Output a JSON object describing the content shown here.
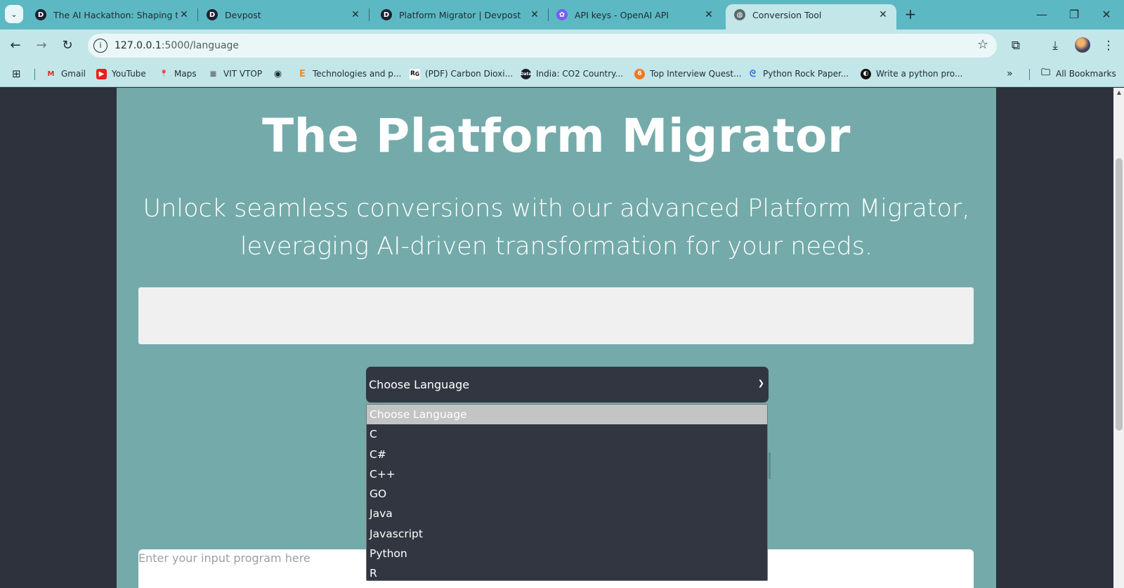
{
  "browser": {
    "tabs": [
      {
        "title": "The AI Hackathon: Shaping the",
        "favicon": "D"
      },
      {
        "title": "Devpost",
        "favicon": "D"
      },
      {
        "title": "Platform Migrator | Devpost",
        "favicon": "D"
      },
      {
        "title": "API keys - OpenAI API",
        "favicon": "openai-icon"
      },
      {
        "title": "Conversion Tool",
        "favicon": "globe-icon",
        "active": true
      }
    ],
    "url_host": "127.0.0.1",
    "url_rest": ":5000/language",
    "bookmarks": [
      {
        "label": "Gmail",
        "icon": "gmail-icon"
      },
      {
        "label": "YouTube",
        "icon": "youtube-icon"
      },
      {
        "label": "Maps",
        "icon": "maps-icon"
      },
      {
        "label": "VIT VTOP",
        "icon": "vit-icon"
      },
      {
        "label": "",
        "icon": "globe-icon"
      },
      {
        "label": "Technologies and p...",
        "icon": "e-icon"
      },
      {
        "label": "(PDF) Carbon Dioxi...",
        "icon": "researchgate-icon"
      },
      {
        "label": "India: CO2 Country...",
        "icon": "data-icon"
      },
      {
        "label": "Top Interview Quest...",
        "icon": "leetcode-icon"
      },
      {
        "label": "Python Rock Paper...",
        "icon": "python-icon"
      },
      {
        "label": "Write a python pro...",
        "icon": "github-icon"
      }
    ],
    "all_bookmarks_label": "All Bookmarks"
  },
  "page": {
    "heading": "The Platform Migrator",
    "subtitle": "Unlock seamless conversions with our advanced Platform Migrator, leveraging AI-driven transformation for your needs.",
    "select_value": "Choose Language",
    "options": [
      "Choose Language",
      "C",
      "C#",
      "C++",
      "GO",
      "Java",
      "Javascript",
      "Python",
      "R"
    ],
    "input_placeholder": "Enter your input program here"
  },
  "colors": {
    "tab_bar": "#5cb8c2",
    "toolbar": "#c3e6e9",
    "page_bg": "#2e323c",
    "content_bg": "#74aaaa",
    "select_bg": "#323640"
  }
}
